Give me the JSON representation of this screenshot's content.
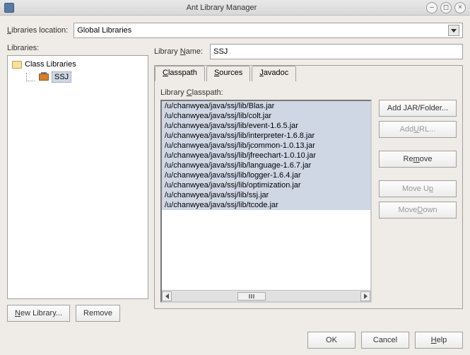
{
  "window": {
    "title": "Ant Library Manager"
  },
  "librariesLocation": {
    "label": "Libraries location:",
    "value": "Global Libraries"
  },
  "librariesLabel": "Libraries:",
  "tree": {
    "root": "Class Libraries",
    "selected": "SSJ"
  },
  "leftButtons": {
    "newLibrary": "New Library...",
    "remove": "Remove"
  },
  "libraryName": {
    "label": "Library Name:",
    "value": "SSJ"
  },
  "tabs": {
    "classpath": "Classpath",
    "sources": "Sources",
    "javadoc": "Javadoc"
  },
  "classpath": {
    "label": "Library Classpath:",
    "items": [
      "/u/chanwyea/java/ssj/lib/Blas.jar",
      "/u/chanwyea/java/ssj/lib/colt.jar",
      "/u/chanwyea/java/ssj/lib/event-1.6.5.jar",
      "/u/chanwyea/java/ssj/lib/interpreter-1.6.8.jar",
      "/u/chanwyea/java/ssj/lib/jcommon-1.0.13.jar",
      "/u/chanwyea/java/ssj/lib/jfreechart-1.0.10.jar",
      "/u/chanwyea/java/ssj/lib/language-1.6.7.jar",
      "/u/chanwyea/java/ssj/lib/logger-1.6.4.jar",
      "/u/chanwyea/java/ssj/lib/optimization.jar",
      "/u/chanwyea/java/ssj/lib/ssj.jar",
      "/u/chanwyea/java/ssj/lib/tcode.jar"
    ]
  },
  "sideButtons": {
    "addJar": "Add JAR/Folder...",
    "addUrl": "Add URL...",
    "remove": "Remove",
    "moveUp": "Move Up",
    "moveDown": "Move Down"
  },
  "footer": {
    "ok": "OK",
    "cancel": "Cancel",
    "help": "Help"
  }
}
